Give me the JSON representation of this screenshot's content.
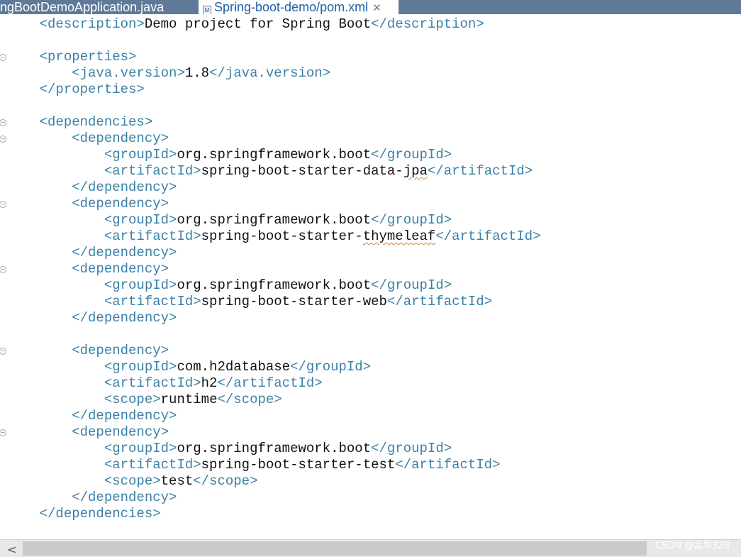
{
  "tabs": {
    "inactive_label": "ringBootDemoApplication.java",
    "active_icon": "M",
    "active_label": "Spring-boot-demo/pom.xml",
    "close": "✕"
  },
  "lines": [
    {
      "indent": "    ",
      "open": "<description>",
      "text": "Demo project for Spring Boot",
      "close": "</description>"
    },
    {
      "indent": "",
      "open": "",
      "text": "",
      "close": ""
    },
    {
      "indent": "    ",
      "open": "<properties>",
      "text": "",
      "close": ""
    },
    {
      "indent": "        ",
      "open": "<java.version>",
      "text": "1.8",
      "close": "</java.version>"
    },
    {
      "indent": "    ",
      "open": "",
      "text": "",
      "close": "</properties>"
    },
    {
      "indent": "",
      "open": "",
      "text": "",
      "close": ""
    },
    {
      "indent": "    ",
      "open": "<dependencies>",
      "text": "",
      "close": ""
    },
    {
      "indent": "        ",
      "open": "<dependency>",
      "text": "",
      "close": ""
    },
    {
      "indent": "            ",
      "open": "<groupId>",
      "text": "org.springframework.boot",
      "close": "</groupId>"
    },
    {
      "indent": "            ",
      "open": "<artifactId>",
      "text": "spring-boot-starter-data-jpa",
      "close": "</artifactId>"
    },
    {
      "indent": "        ",
      "open": "",
      "text": "",
      "close": "</dependency>"
    },
    {
      "indent": "        ",
      "open": "<dependency>",
      "text": "",
      "close": ""
    },
    {
      "indent": "            ",
      "open": "<groupId>",
      "text": "org.springframework.boot",
      "close": "</groupId>"
    },
    {
      "indent": "            ",
      "open": "<artifactId>",
      "text": "spring-boot-starter-thymeleaf",
      "close": "</artifactId>"
    },
    {
      "indent": "        ",
      "open": "",
      "text": "",
      "close": "</dependency>"
    },
    {
      "indent": "        ",
      "open": "<dependency>",
      "text": "",
      "close": ""
    },
    {
      "indent": "            ",
      "open": "<groupId>",
      "text": "org.springframework.boot",
      "close": "</groupId>"
    },
    {
      "indent": "            ",
      "open": "<artifactId>",
      "text": "spring-boot-starter-web",
      "close": "</artifactId>"
    },
    {
      "indent": "        ",
      "open": "",
      "text": "",
      "close": "</dependency>"
    },
    {
      "indent": "",
      "open": "",
      "text": "",
      "close": ""
    },
    {
      "indent": "        ",
      "open": "<dependency>",
      "text": "",
      "close": ""
    },
    {
      "indent": "            ",
      "open": "<groupId>",
      "text": "com.h2database",
      "close": "</groupId>"
    },
    {
      "indent": "            ",
      "open": "<artifactId>",
      "text": "h2",
      "close": "</artifactId>"
    },
    {
      "indent": "            ",
      "open": "<scope>",
      "text": "runtime",
      "close": "</scope>"
    },
    {
      "indent": "        ",
      "open": "",
      "text": "",
      "close": "</dependency>"
    },
    {
      "indent": "        ",
      "open": "<dependency>",
      "text": "",
      "close": ""
    },
    {
      "indent": "            ",
      "open": "<groupId>",
      "text": "org.springframework.boot",
      "close": "</groupId>"
    },
    {
      "indent": "            ",
      "open": "<artifactId>",
      "text": "spring-boot-starter-test",
      "close": "</artifactId>"
    },
    {
      "indent": "            ",
      "open": "<scope>",
      "text": "test",
      "close": "</scope>"
    },
    {
      "indent": "        ",
      "open": "",
      "text": "",
      "close": "</dependency>"
    },
    {
      "indent": "    ",
      "open": "",
      "text": "",
      "close": "</dependencies>"
    }
  ],
  "fold_markers": [
    2,
    6,
    7,
    11,
    15,
    20,
    25
  ],
  "squiggle_words": [
    {
      "line": 9,
      "word": "jpa"
    },
    {
      "line": 13,
      "word": "thymeleaf"
    }
  ],
  "scrollbar": {
    "left_arrow": "<"
  },
  "watermark": "CSDN @孟华328",
  "colors": {
    "tag": "#3a80a8",
    "text": "#111111",
    "tabbar": "#5f7a99",
    "active_tab_text": "#1f5fa8"
  }
}
